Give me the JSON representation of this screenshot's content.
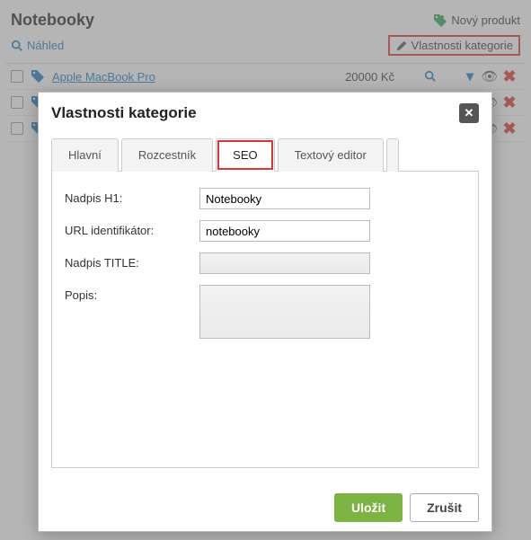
{
  "header": {
    "title": "Notebooky",
    "new_product": "Nový produkt",
    "preview": "Náhled",
    "category_properties": "Vlastnosti kategorie"
  },
  "list": {
    "rows": [
      {
        "name": "Apple MacBook Pro",
        "price": "20000 Kč"
      },
      {
        "name": "",
        "price": ""
      },
      {
        "name": "",
        "price": ""
      }
    ]
  },
  "modal": {
    "title": "Vlastnosti kategorie",
    "tabs": {
      "main": "Hlavní",
      "signpost": "Rozcestník",
      "seo": "SEO",
      "editor": "Textový editor"
    },
    "form": {
      "h1_label": "Nadpis H1:",
      "h1_value": "Notebooky",
      "url_label": "URL identifikátor:",
      "url_value": "notebooky",
      "title_label": "Nadpis TITLE:",
      "title_value": "",
      "desc_label": "Popis:",
      "desc_value": ""
    },
    "buttons": {
      "save": "Uložit",
      "cancel": "Zrušit"
    }
  }
}
